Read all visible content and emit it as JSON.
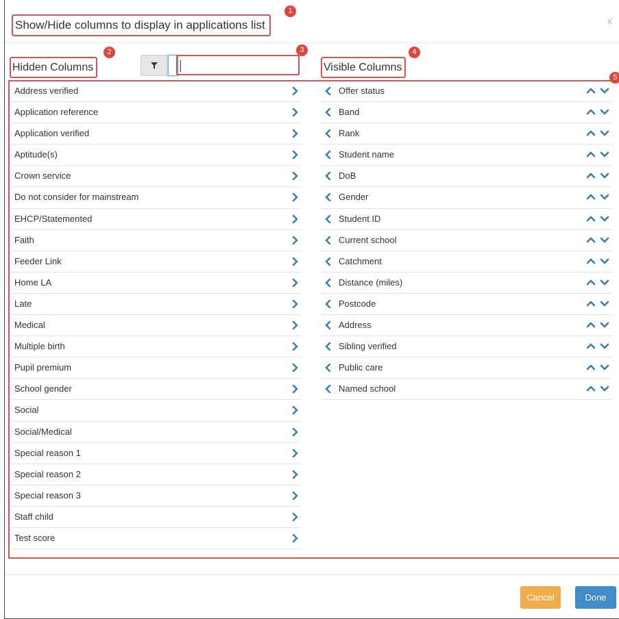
{
  "dialog": {
    "title": "Show/Hide columns to display in applications list",
    "close_label": "x"
  },
  "badges": [
    "1",
    "2",
    "3",
    "4",
    "5"
  ],
  "hidden": {
    "title": "Hidden Columns",
    "search_placeholder": "",
    "items": [
      "Address verified",
      "Application reference",
      "Application verified",
      "Aptitude(s)",
      "Crown service",
      "Do not consider for mainstream",
      "EHCP/Statemented",
      "Faith",
      "Feeder Link",
      "Home LA",
      "Late",
      "Medical",
      "Multiple birth",
      "Pupil premium",
      "School gender",
      "Social",
      "Social/Medical",
      "Special reason 1",
      "Special reason 2",
      "Special reason 3",
      "Staff child",
      "Test score"
    ]
  },
  "visible": {
    "title": "Visible Columns",
    "items": [
      "Offer status",
      "Band",
      "Rank",
      "Student name",
      "DoB",
      "Gender",
      "Student ID",
      "Current school",
      "Catchment",
      "Distance (miles)",
      "Postcode",
      "Address",
      "Sibling verified",
      "Public care",
      "Named school"
    ]
  },
  "footer": {
    "cancel_label": "Cancel",
    "done_label": "Done"
  },
  "colors": {
    "annotation_red": "#d9534f",
    "badge_red": "#e2453c",
    "arrow_blue": "#337ab7",
    "cancel_orange": "#f0ad4e",
    "done_blue": "#428bca"
  },
  "icons": {
    "filter": "filter-icon",
    "move_right": "chevron-right-icon",
    "move_left": "chevron-left-icon",
    "move_up": "chevron-up-icon",
    "move_down": "chevron-down-icon"
  }
}
